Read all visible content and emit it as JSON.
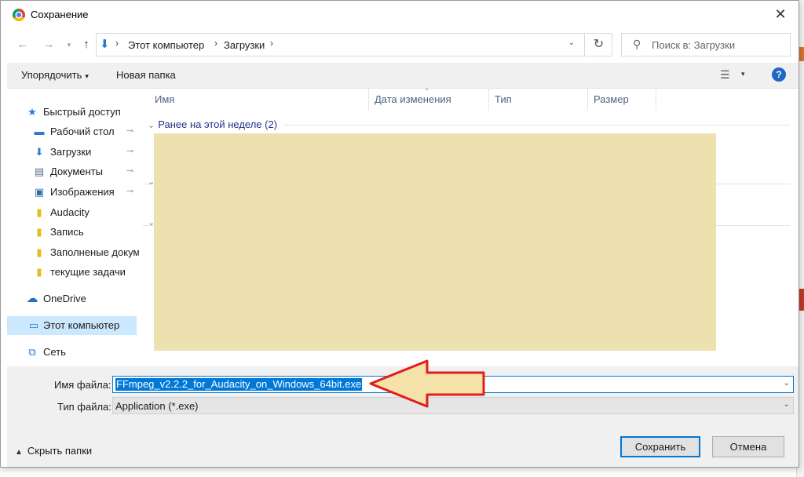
{
  "window": {
    "title": "Сохранение",
    "close_glyph": "✕"
  },
  "nav": {
    "back_glyph": "←",
    "forward_glyph": "→",
    "recent_glyph": "▾",
    "up_glyph": "↑",
    "refresh_glyph": "↻"
  },
  "address": {
    "segments": [
      "Этот компьютер",
      "Загрузки"
    ],
    "separator": "›",
    "dropdown_glyph": "⌄"
  },
  "search": {
    "placeholder": "Поиск в: Загрузки",
    "icon": "search-icon"
  },
  "toolbar": {
    "organize_label": "Упорядочить",
    "organize_caret": "▾",
    "new_folder_label": "Новая папка",
    "view_glyph": "☰",
    "view_caret": "▾",
    "help_glyph": "?"
  },
  "sidebar": {
    "quick_access": "Быстрый доступ",
    "items": [
      {
        "label": "Рабочий стол",
        "icon": "desktop-icon",
        "pinned": true
      },
      {
        "label": "Загрузки",
        "icon": "downloads-icon",
        "pinned": true
      },
      {
        "label": "Документы",
        "icon": "documents-icon",
        "pinned": true
      },
      {
        "label": "Изображения",
        "icon": "pictures-icon",
        "pinned": true
      },
      {
        "label": "Audacity",
        "icon": "folder-icon",
        "pinned": false
      },
      {
        "label": "Запись",
        "icon": "folder-icon",
        "pinned": false
      },
      {
        "label": "Заполненые докум",
        "icon": "folder-icon",
        "pinned": false
      },
      {
        "label": "текущие задачи",
        "icon": "folder-icon",
        "pinned": false
      }
    ],
    "onedrive": "OneDrive",
    "this_pc": "Этот компьютер",
    "network": "Сеть",
    "pin_glyph": "📌"
  },
  "file_list": {
    "columns": [
      "Имя",
      "Дата изменения",
      "Тип",
      "Размер"
    ],
    "group_header": "Ранее на этой неделе (2)",
    "group_chevron": "⌄"
  },
  "save_panel": {
    "filename_label": "Имя файла:",
    "filename_value": "FFmpeg_v2.2.2_for_Audacity_on_Windows_64bit.exe",
    "filetype_label": "Тип файла:",
    "filetype_value": "Application (*.exe)",
    "dropdown_glyph": "⌄",
    "hide_folders_label": "Скрыть папки",
    "hide_folders_caret": "▲",
    "save_label": "Сохранить",
    "cancel_label": "Отмена"
  },
  "colors": {
    "accent": "#0078d7",
    "redaction": "#ede1b0",
    "arrow_fill": "#f5e2a8",
    "arrow_stroke": "#e11d1d"
  }
}
